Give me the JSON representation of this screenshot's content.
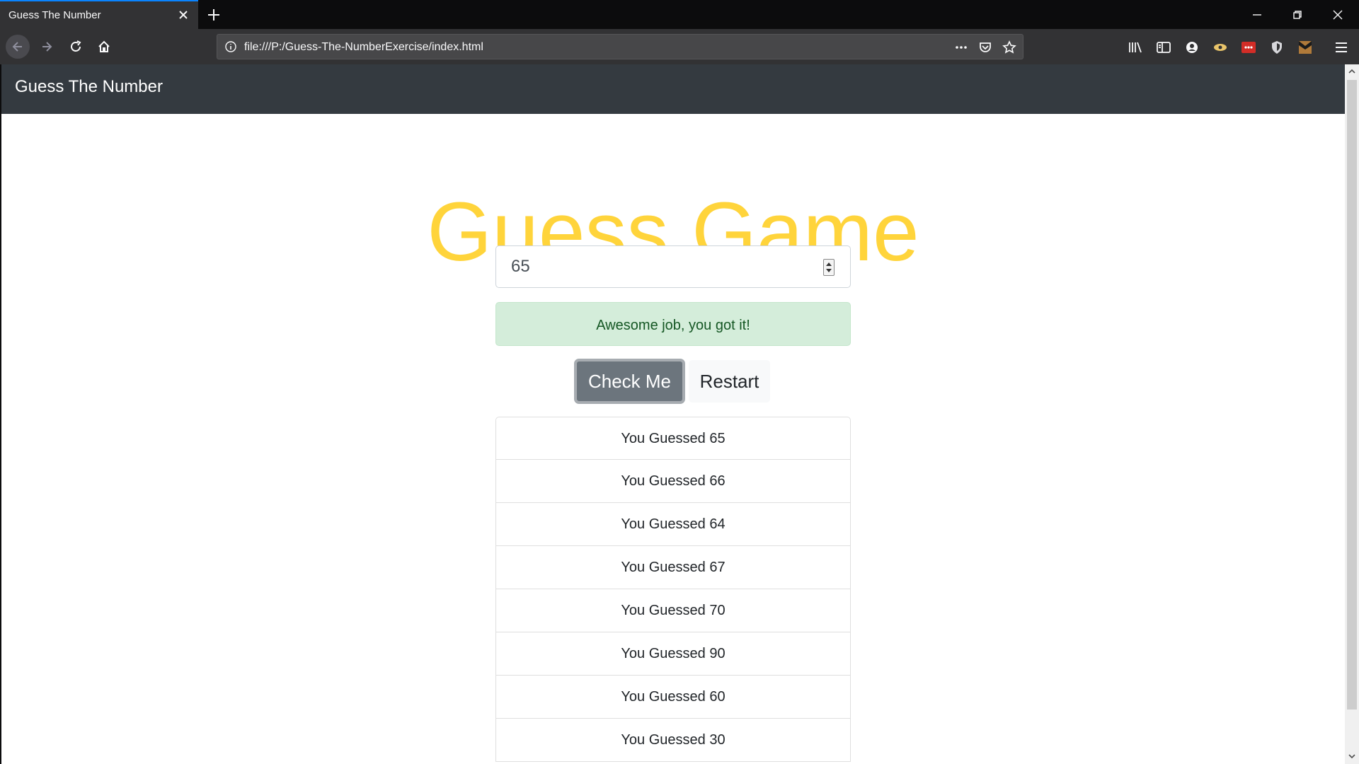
{
  "browser": {
    "tab_title": "Guess The Number",
    "url": "file:///P:/Guess-The-NumberExercise/index.html"
  },
  "site": {
    "brand": "Guess The Number"
  },
  "game": {
    "title": "Guess Game",
    "input_value": "65",
    "alert_text": "Awesome job, you got it!",
    "check_label": "Check Me",
    "restart_label": "Restart",
    "guesses": [
      "You Guessed 65",
      "You Guessed 66",
      "You Guessed 64",
      "You Guessed 67",
      "You Guessed 70",
      "You Guessed 90",
      "You Guessed 60",
      "You Guessed 30"
    ]
  },
  "colors": {
    "title": "#ffd43b",
    "navbar": "#343a40",
    "success_bg": "#d4edda",
    "success_text": "#155724",
    "check_button": "#6c757d"
  }
}
